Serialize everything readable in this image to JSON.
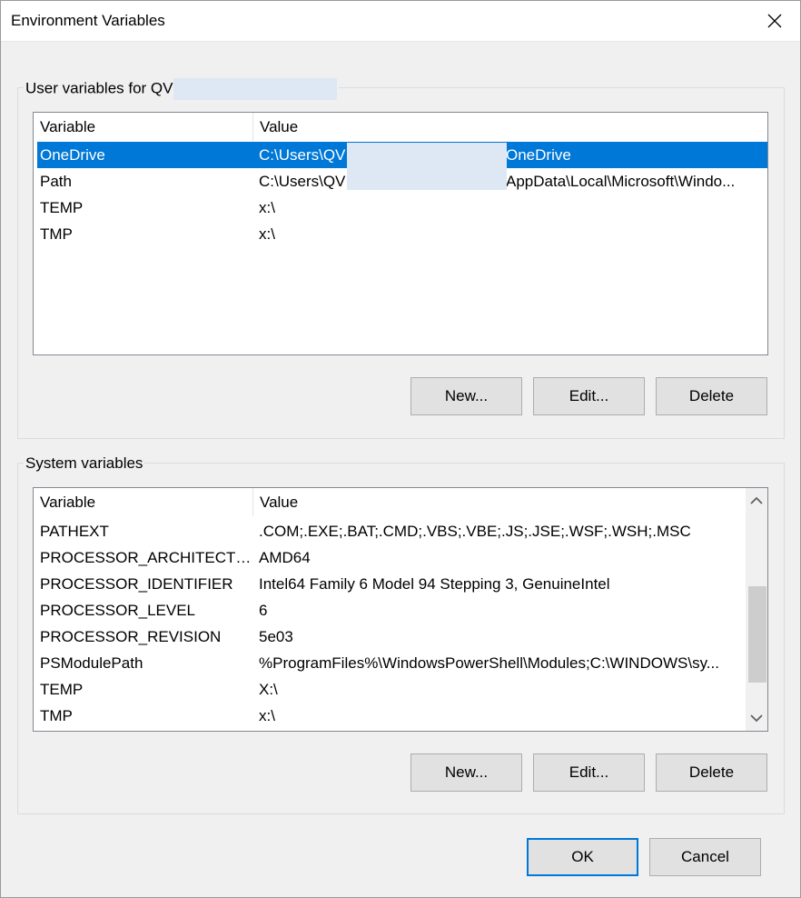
{
  "window": {
    "title": "Environment Variables",
    "close_icon": "close-icon"
  },
  "user_vars": {
    "group_label": "User variables for QV",
    "columns": {
      "variable": "Variable",
      "value": "Value"
    },
    "rows": [
      {
        "name": "OneDrive",
        "value_a": "C:\\Users\\QV",
        "value_b": "OneDrive",
        "selected": true
      },
      {
        "name": "Path",
        "value_a": "C:\\Users\\QV",
        "value_b": "AppData\\Local\\Microsoft\\Windo...",
        "selected": false
      },
      {
        "name": "TEMP",
        "value_a": "x:\\",
        "value_b": "",
        "selected": false
      },
      {
        "name": "TMP",
        "value_a": "x:\\",
        "value_b": "",
        "selected": false
      }
    ],
    "buttons": {
      "new": "New...",
      "edit": "Edit...",
      "delete": "Delete"
    }
  },
  "system_vars": {
    "group_label": "System variables",
    "columns": {
      "variable": "Variable",
      "value": "Value"
    },
    "rows": [
      {
        "name": "PATHEXT",
        "value": ".COM;.EXE;.BAT;.CMD;.VBS;.VBE;.JS;.JSE;.WSF;.WSH;.MSC"
      },
      {
        "name": "PROCESSOR_ARCHITECTURE",
        "value": "AMD64"
      },
      {
        "name": "PROCESSOR_IDENTIFIER",
        "value": "Intel64 Family 6 Model 94 Stepping 3, GenuineIntel"
      },
      {
        "name": "PROCESSOR_LEVEL",
        "value": "6"
      },
      {
        "name": "PROCESSOR_REVISION",
        "value": "5e03"
      },
      {
        "name": "PSModulePath",
        "value": "%ProgramFiles%\\WindowsPowerShell\\Modules;C:\\WINDOWS\\sy..."
      },
      {
        "name": "TEMP",
        "value": "X:\\"
      },
      {
        "name": "TMP",
        "value": "x:\\"
      }
    ],
    "buttons": {
      "new": "New...",
      "edit": "Edit...",
      "delete": "Delete"
    },
    "scroll_position": 0.62
  },
  "footer": {
    "ok": "OK",
    "cancel": "Cancel"
  },
  "colors": {
    "selection": "#0078d7",
    "redaction": "#dde8f4"
  }
}
